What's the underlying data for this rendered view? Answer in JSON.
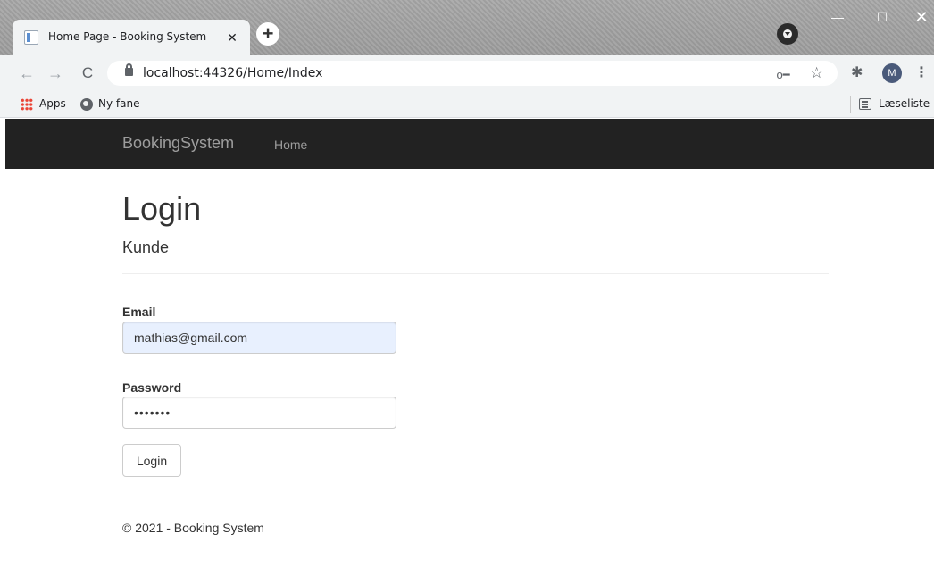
{
  "browser": {
    "tab": {
      "title": "Home Page - Booking System",
      "close_glyph": "✕"
    },
    "new_tab_glyph": "+",
    "window": {
      "minimize": "—",
      "maximize": "☐",
      "close": "✕"
    },
    "nav": {
      "back": "←",
      "forward": "→",
      "reload": "C"
    },
    "url": "localhost:44326/Home/Index",
    "key_glyph": "o━",
    "star_glyph": "☆",
    "extensions_glyph": "✱",
    "avatar_initial": "M",
    "menu_glyph": "⋮",
    "bookmarks": {
      "apps": "Apps",
      "ny_fane": "Ny fane",
      "reading_list": "Læseliste"
    }
  },
  "navbar": {
    "brand": "BookingSystem",
    "home": "Home"
  },
  "login": {
    "title": "Login",
    "subtitle": "Kunde",
    "email_label": "Email",
    "email_value": "mathias@gmail.com",
    "password_label": "Password",
    "password_value": "•••••••",
    "submit_label": "Login"
  },
  "footer": {
    "text": "© 2021 - Booking System"
  },
  "colors": {
    "navbar_bg": "#222222",
    "navbar_text": "#9d9d9d",
    "autofill_bg": "#e8f0fe"
  }
}
